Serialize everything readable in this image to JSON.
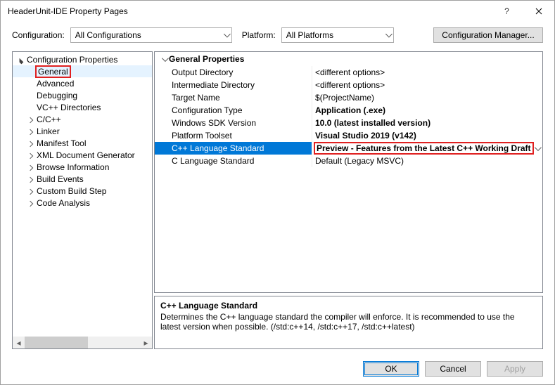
{
  "titlebar": {
    "title": "HeaderUnit-IDE Property Pages"
  },
  "toprow": {
    "config_label": "Configuration:",
    "config_value": "All Configurations",
    "platform_label": "Platform:",
    "platform_value": "All Platforms",
    "manager_btn": "Configuration Manager..."
  },
  "tree": {
    "root": "Configuration Properties",
    "items": [
      {
        "label": "General",
        "selected": true,
        "highlight": true,
        "expandable": false
      },
      {
        "label": "Advanced",
        "expandable": false
      },
      {
        "label": "Debugging",
        "expandable": false
      },
      {
        "label": "VC++ Directories",
        "expandable": false
      },
      {
        "label": "C/C++",
        "expandable": true
      },
      {
        "label": "Linker",
        "expandable": true
      },
      {
        "label": "Manifest Tool",
        "expandable": true
      },
      {
        "label": "XML Document Generator",
        "expandable": true
      },
      {
        "label": "Browse Information",
        "expandable": true
      },
      {
        "label": "Build Events",
        "expandable": true
      },
      {
        "label": "Custom Build Step",
        "expandable": true
      },
      {
        "label": "Code Analysis",
        "expandable": true
      }
    ]
  },
  "props": {
    "group": "General Properties",
    "rows": [
      {
        "name": "Output Directory",
        "value": "<different options>",
        "bold": false
      },
      {
        "name": "Intermediate Directory",
        "value": "<different options>",
        "bold": false
      },
      {
        "name": "Target Name",
        "value": "$(ProjectName)",
        "bold": false
      },
      {
        "name": "Configuration Type",
        "value": "Application (.exe)",
        "bold": true
      },
      {
        "name": "Windows SDK Version",
        "value": "10.0 (latest installed version)",
        "bold": true
      },
      {
        "name": "Platform Toolset",
        "value": "Visual Studio 2019 (v142)",
        "bold": true
      },
      {
        "name": "C++ Language Standard",
        "value": "Preview - Features from the Latest C++ Working Draft",
        "bold": true,
        "selected": true,
        "value_highlight": true,
        "dropdown": true
      },
      {
        "name": "C Language Standard",
        "value": "Default (Legacy MSVC)",
        "bold": false
      }
    ]
  },
  "desc": {
    "title": "C++ Language Standard",
    "text": "Determines the C++ language standard the compiler will enforce. It is recommended to use the latest version when possible.   (/std:c++14, /std:c++17, /std:c++latest)"
  },
  "footer": {
    "ok": "OK",
    "cancel": "Cancel",
    "apply": "Apply"
  }
}
